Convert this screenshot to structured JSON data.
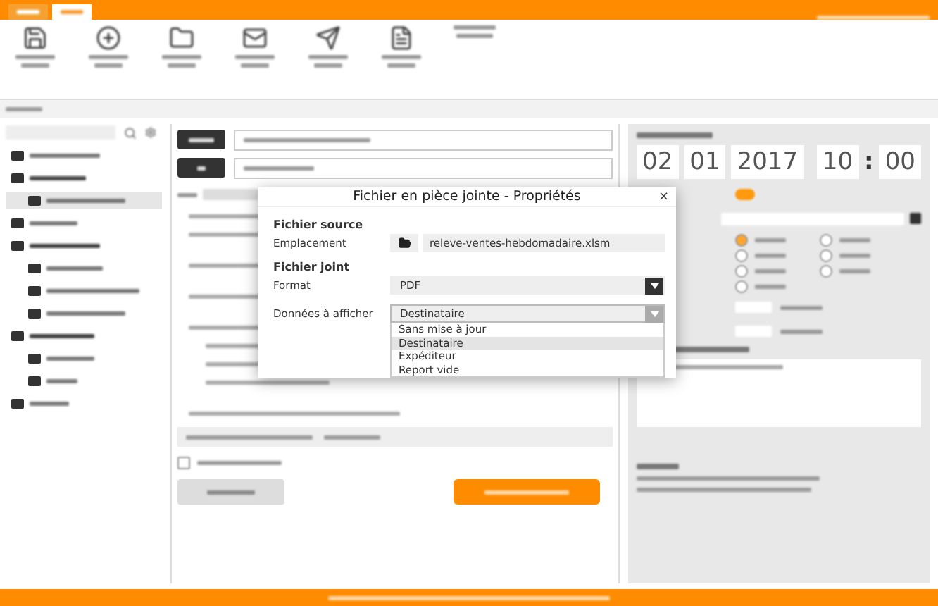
{
  "message": {
    "send_copy_checked": false
  },
  "schedule": {
    "date": [
      "02",
      "01",
      "2017"
    ],
    "time": [
      "10",
      "00"
    ],
    "time_separator": ":",
    "toggle_on": true,
    "weekdays": [
      {
        "selected": true
      },
      {
        "selected": false
      },
      {
        "selected": false
      },
      {
        "selected": false
      },
      {
        "selected": false
      },
      {
        "selected": false
      },
      {
        "selected": false
      }
    ]
  },
  "dialog": {
    "title": "Fichier en pièce jointe - Propriétés",
    "close": "×",
    "sections": [
      {
        "heading": "Fichier source",
        "fields": [
          {
            "kind": "file",
            "label": "Emplacement",
            "value": "releve-ventes-hebdomadaire.xlsm"
          }
        ]
      },
      {
        "heading": "Fichier joint",
        "fields": [
          {
            "kind": "select",
            "label": "Format",
            "value": "PDF",
            "open": false
          },
          {
            "kind": "select",
            "label": "Données à afficher",
            "value": "Destinataire",
            "open": true,
            "options": [
              {
                "label": "Sans mise à jour",
                "selected": false
              },
              {
                "label": "Destinataire",
                "selected": true
              },
              {
                "label": "Expéditeur",
                "selected": false
              },
              {
                "label": "Report vide",
                "selected": false
              }
            ]
          }
        ]
      }
    ]
  }
}
